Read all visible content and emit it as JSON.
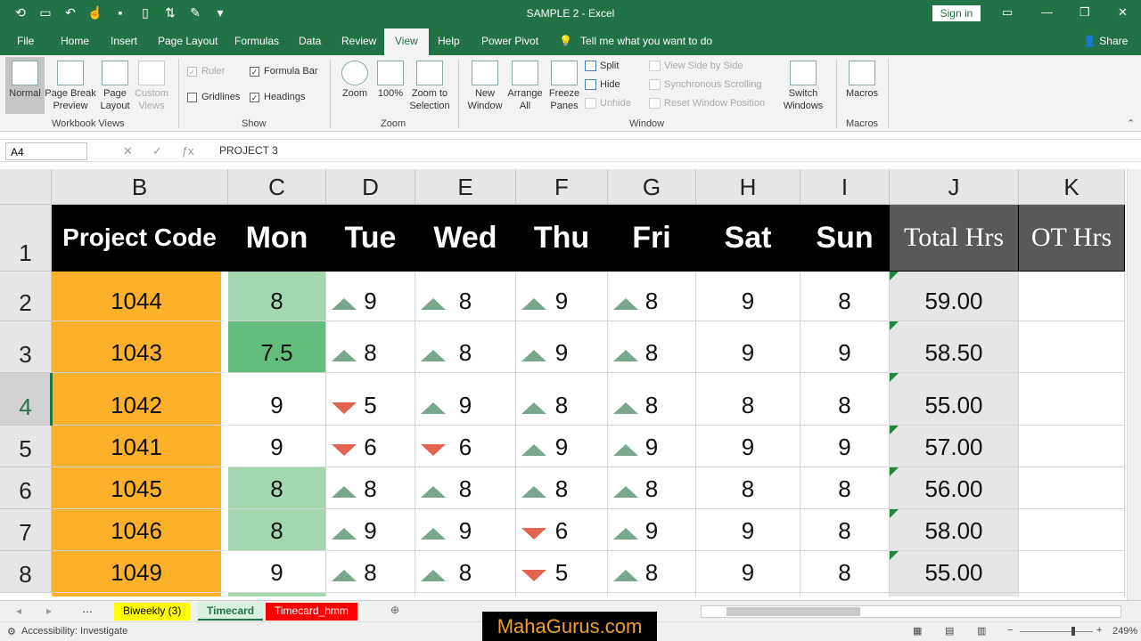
{
  "title": "SAMPLE 2  -  Excel",
  "signin": "Sign in",
  "tabs": [
    "File",
    "Home",
    "Insert",
    "Page Layout",
    "Formulas",
    "Data",
    "Review",
    "View",
    "Help",
    "Power Pivot"
  ],
  "tell_me": "Tell me what you want to do",
  "share": "Share",
  "ribbon": {
    "workbook_views": {
      "normal": "Normal",
      "page_break": "Page Break Preview",
      "page_layout": "Page Layout",
      "custom_views": "Custom Views",
      "group": "Workbook Views"
    },
    "show": {
      "ruler": "Ruler",
      "formula_bar": "Formula Bar",
      "gridlines": "Gridlines",
      "headings": "Headings",
      "group": "Show"
    },
    "zoom": {
      "zoom": "Zoom",
      "hundred": "100%",
      "zoom_sel": "Zoom to Selection",
      "group": "Zoom"
    },
    "window": {
      "new_window": "New Window",
      "arrange": "Arrange All",
      "freeze": "Freeze Panes",
      "split": "Split",
      "hide": "Hide",
      "unhide": "Unhide",
      "side_by_side": "View Side by Side",
      "sync_scroll": "Synchronous Scrolling",
      "reset_pos": "Reset Window Position",
      "switch": "Switch Windows",
      "group": "Window"
    },
    "macros": {
      "macros": "Macros",
      "group": "Macros"
    }
  },
  "namebox": "A4",
  "formula": "PROJECT 3",
  "columns": [
    "B",
    "C",
    "D",
    "E",
    "F",
    "G",
    "H",
    "I",
    "J",
    "K"
  ],
  "rows": [
    "1",
    "2",
    "3",
    "4",
    "5",
    "6",
    "7",
    "8"
  ],
  "header": {
    "code": "Project Code",
    "days": [
      "Mon",
      "Tue",
      "Wed",
      "Thu",
      "Fri",
      "Sat",
      "Sun"
    ],
    "total": "Total Hrs",
    "ot": "OT Hrs"
  },
  "data": [
    {
      "code": "1044",
      "mon": "8",
      "tue": "9",
      "wed": "8",
      "thu": "9",
      "fri": "8",
      "sat": "9",
      "sun": "8",
      "total": "59.00"
    },
    {
      "code": "1043",
      "mon": "7.5",
      "tue": "8",
      "wed": "8",
      "thu": "9",
      "fri": "8",
      "sat": "9",
      "sun": "9",
      "total": "58.50"
    },
    {
      "code": "1042",
      "mon": "9",
      "tue": "5",
      "wed": "9",
      "thu": "8",
      "fri": "8",
      "sat": "8",
      "sun": "8",
      "total": "55.00"
    },
    {
      "code": "1041",
      "mon": "9",
      "tue": "6",
      "wed": "6",
      "thu": "9",
      "fri": "9",
      "sat": "9",
      "sun": "9",
      "total": "57.00"
    },
    {
      "code": "1045",
      "mon": "8",
      "tue": "8",
      "wed": "8",
      "thu": "8",
      "fri": "8",
      "sat": "8",
      "sun": "8",
      "total": "56.00"
    },
    {
      "code": "1046",
      "mon": "8",
      "tue": "9",
      "wed": "9",
      "thu": "6",
      "fri": "9",
      "sat": "9",
      "sun": "8",
      "total": "58.00"
    },
    {
      "code": "1049",
      "mon": "9",
      "tue": "8",
      "wed": "8",
      "thu": "5",
      "fri": "8",
      "sat": "9",
      "sun": "8",
      "total": "55.00"
    }
  ],
  "sheets": [
    "Biweekly (3)",
    "Timecard",
    "Timecard_hmm"
  ],
  "status": "Accessibility: Investigate",
  "zoom_level": "249%",
  "watermark": "MahaGurus.com"
}
